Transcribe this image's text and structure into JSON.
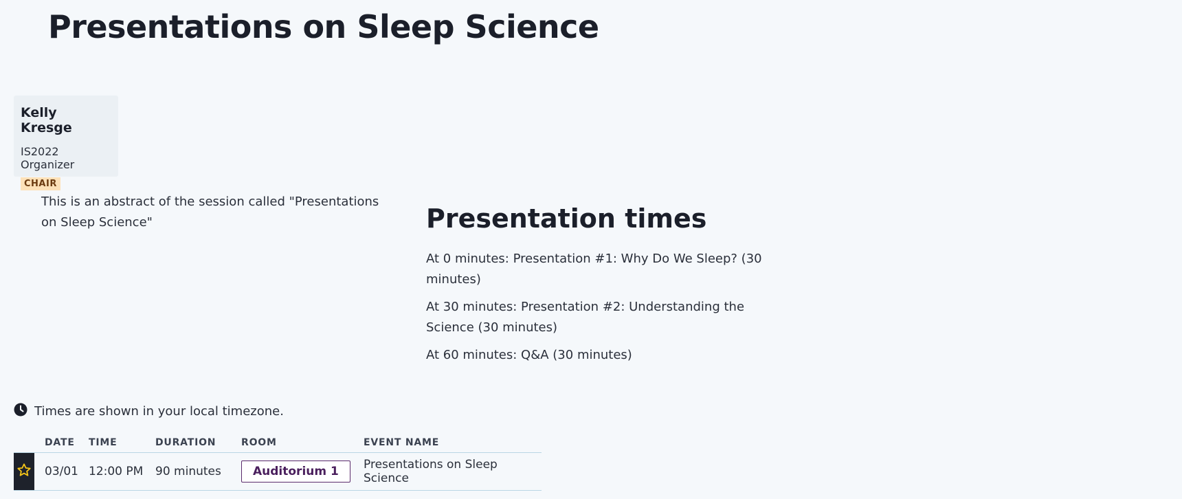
{
  "page": {
    "title": "Presentations on Sleep Science"
  },
  "chair": {
    "name": "Kelly Kresge",
    "role": "IS2022 Organizer",
    "badge": "CHAIR"
  },
  "abstract": "This is an abstract of the session called \"Presentations on Sleep Science\"",
  "presentation_times": {
    "heading": "Presentation times",
    "items": [
      "At 0 minutes: Presentation #1: Why Do We Sleep? (30 minutes)",
      "At 30 minutes: Presentation #2: Understanding the Science (30 minutes)",
      "At 60 minutes: Q&A (30 minutes)"
    ]
  },
  "timezone_note": {
    "icon": "clock-icon",
    "text": "Times are shown in your local timezone."
  },
  "schedule": {
    "headers": {
      "date": "DATE",
      "time": "TIME",
      "duration": "DURATION",
      "room": "ROOM",
      "event_name": "EVENT NAME"
    },
    "rows": [
      {
        "favorite_icon": "star-outline-icon",
        "date": "03/01",
        "time": "12:00 PM",
        "duration": "90 minutes",
        "room": "Auditorium 1",
        "event_name": "Presentations on Sleep Science"
      }
    ]
  },
  "colors": {
    "background": "#f5f8fb",
    "star": "#f5c518",
    "badge_bg": "#fde1b8",
    "room_border": "#5a2a6b"
  }
}
